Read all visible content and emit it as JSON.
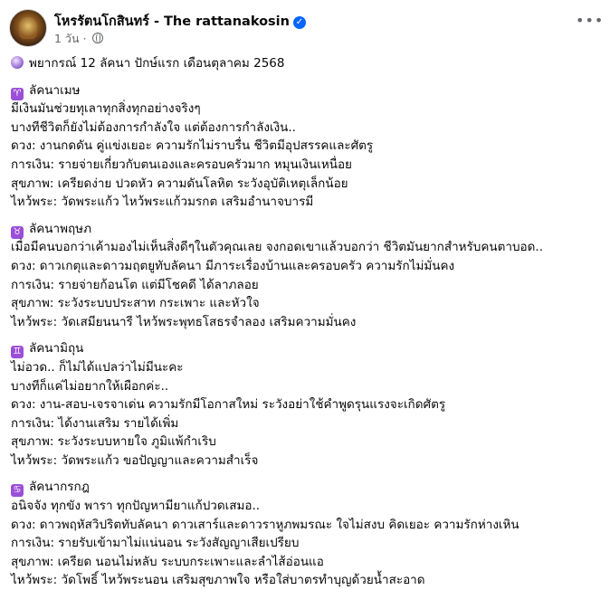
{
  "header": {
    "page_name": "โหรรัตนโกสินทร์ - The rattanakosin",
    "time": "1 วัน",
    "dot": "·"
  },
  "icons": {
    "verified": "verified-badge-icon",
    "globe": "globe-icon",
    "more": "more-options-icon",
    "crystal": "crystal-ball-icon",
    "zodiac": [
      "aries-icon",
      "taurus-icon",
      "gemini-icon",
      "cancer-icon"
    ]
  },
  "colors": {
    "verified": "#0866ff",
    "zodiac_badge": "#9b4fd6",
    "meta_text": "#65676b"
  },
  "post": {
    "headline": "พยากรณ์ 12 ลัคนา ปักษ์แรก เดือนตุลาคม 2568",
    "sections": [
      {
        "symbol": "♈",
        "title": "ลัคนาเมษ",
        "lines": [
          "มีเงินมันช่วยทุเลาทุกสิ่งทุกอย่างจริงๆ",
          "บางทีชีวิตก็ยังไม่ต้องการกำลังใจ แต่ต้องการกำลังเงิน..",
          "ดวง: งานกดดัน คู่แข่งเยอะ ความรักไม่ราบรื่น ชีวิตมีอุปสรรคและศัตรู",
          "การเงิน: รายจ่ายเกี่ยวกับตนเองและครอบครัวมาก หมุนเงินเหนื่อย",
          "สุขภาพ: เครียดง่าย ปวดหัว ความดันโลหิต ระวังอุบัติเหตุเล็กน้อย",
          "ไหว้พระ: วัดพระแก้ว ไหว้พระแก้วมรกต เสริมอำนาจบารมี"
        ]
      },
      {
        "symbol": "♉",
        "title": "ลัคนาพฤษภ",
        "lines": [
          "เมื่อมีคนบอกว่าเค้ามองไม่เห็นสิ่งดีๆในตัวคุณเลย จงกอดเขาแล้วบอกว่า ชีวิตมันยากสำหรับคนตาบอด..",
          "ดวง: ดาวเกตุและดาวมฤตยูทับลัคนา มีภาระเรื่องบ้านและครอบครัว ความรักไม่มั่นคง",
          "การเงิน: รายจ่ายก้อนโต แต่มีโชคดี ได้ลาภลอย",
          "สุขภาพ: ระวังระบบประสาท กระเพาะ และหัวใจ",
          "ไหว้พระ: วัดเสมียนนารี ไหว้พระพุทธโสธรจำลอง เสริมความมั่นคง"
        ]
      },
      {
        "symbol": "♊",
        "title": "ลัคนามิถุน",
        "lines": [
          "ไม่อวด.. ก็ไม่ได้แปลว่าไม่มีนะคะ",
          "บางทีก็แค่ไม่อยากให้เผือกค่ะ..",
          "ดวง: งาน-สอบ-เจรจาเด่น ความรักมีโอกาสใหม่ ระวังอย่าใช้คำพูดรุนแรงจะเกิดศัตรู",
          "การเงิน: ได้งานเสริม รายได้เพิ่ม",
          "สุขภาพ: ระวังระบบหายใจ ภูมิแพ้กำเริบ",
          "ไหว้พระ: วัดพระแก้ว ขอปัญญาและความสำเร็จ"
        ]
      },
      {
        "symbol": "♋",
        "title": "ลัคนากรกฎ",
        "lines": [
          "อนิจจัง ทุกขัง พารา ทุกปัญหามียาแก้ปวดเสมอ..",
          "ดวง: ดาวพฤหัสวิปริตทับลัคนา ดาวเสาร์และดาวราหูภพมรณะ ใจไม่สงบ คิดเยอะ ความรักห่างเหิน",
          "การเงิน: รายรับเข้ามาไม่แน่นอน ระวังสัญญาเสียเปรียบ",
          "สุขภาพ: เครียด นอนไม่หลับ ระบบกระเพาะและลำไส้อ่อนแอ",
          "ไหว้พระ: วัดโพธิ์ ไหว้พระนอน เสริมสุขภาพใจ หรือใส่บาตรทำบุญด้วยน้ำสะอาด"
        ]
      }
    ]
  }
}
